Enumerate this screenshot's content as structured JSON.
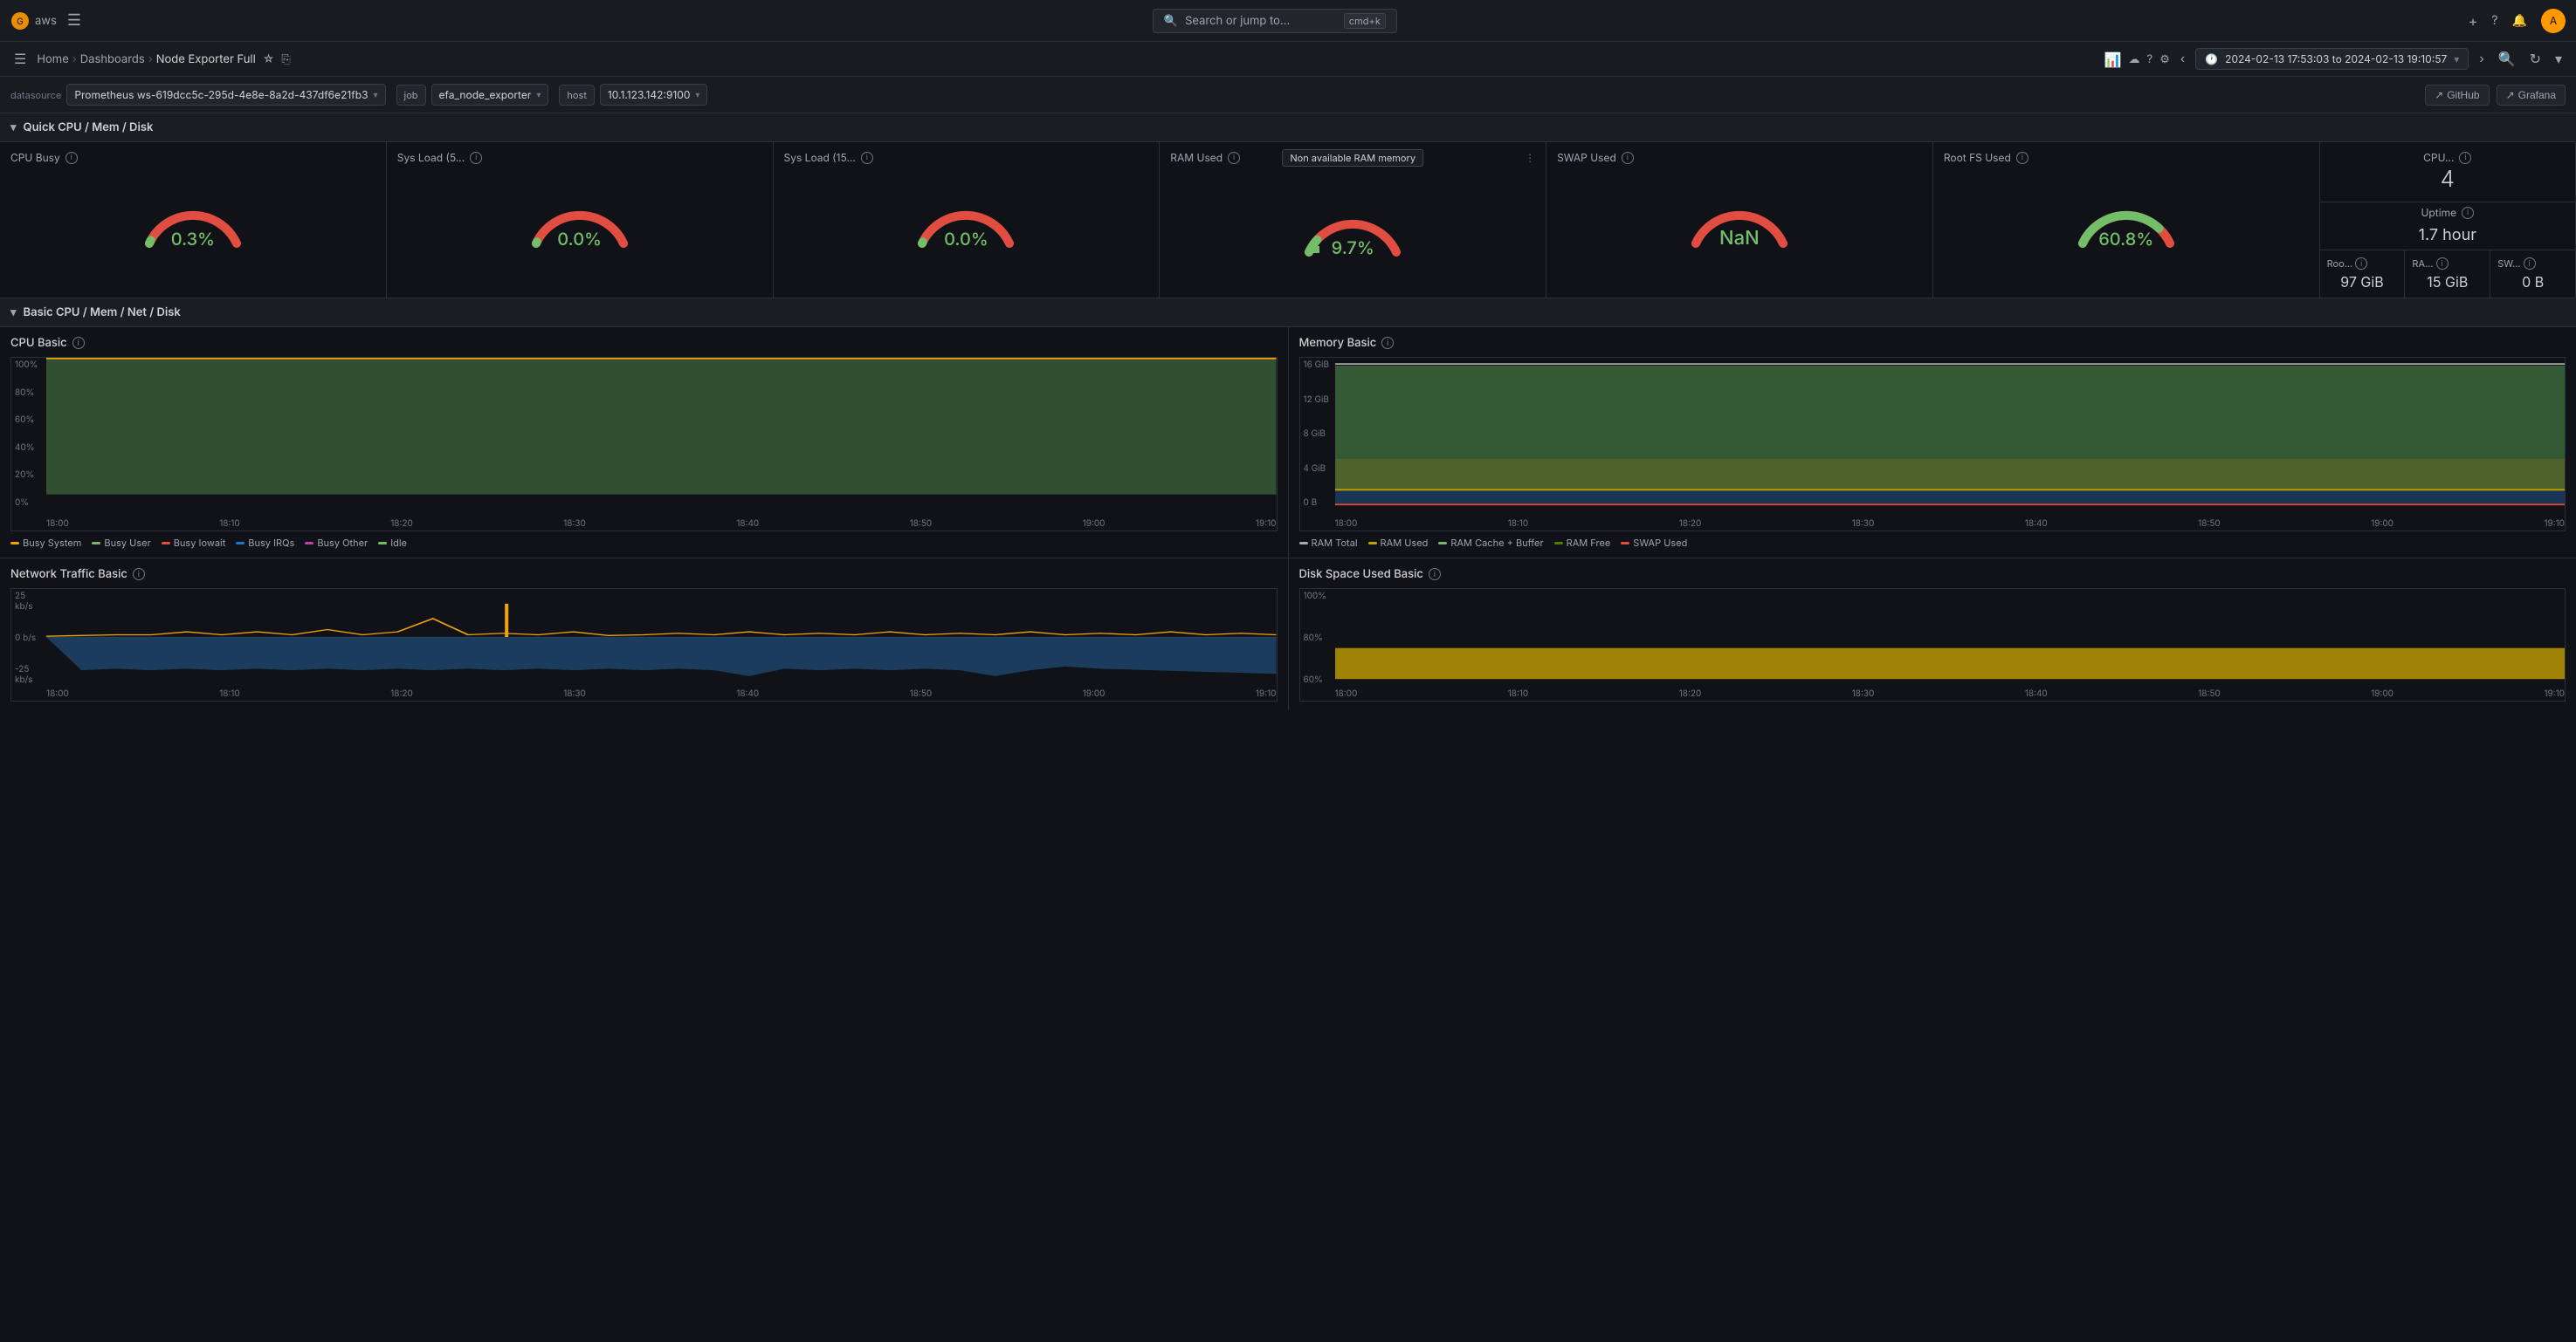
{
  "topnav": {
    "logo": "☁",
    "aws_label": "aws",
    "search_placeholder": "Search or jump to...",
    "shortcut": "cmd+k",
    "icons": [
      "plus",
      "help",
      "bell"
    ],
    "plus_label": "+",
    "help_icon": "?",
    "bell_icon": "🔔"
  },
  "breadcrumb": {
    "home": "Home",
    "dashboards": "Dashboards",
    "page": "Node Exporter Full",
    "time_range": "2024-02-13 17:53:03 to 2024-02-13 19:10:57"
  },
  "filters": {
    "datasource_label": "datasource",
    "datasource_value": "Prometheus ws-619dcc5c-295d-4e8e-8a2d-437df6e21fb3",
    "job_label": "Job",
    "job_value": "efa_node_exporter",
    "host_label": "Host",
    "host_value": "10.1.123.142:9100",
    "github_label": "GitHub",
    "grafana_label": "Grafana"
  },
  "sections": {
    "quick": "Quick CPU / Mem / Disk",
    "basic": "Basic CPU / Mem / Net / Disk"
  },
  "gauges": {
    "cpu_busy": {
      "title": "CPU Busy",
      "value": "0.3%",
      "color": "#73bf69"
    },
    "sys_load_5": {
      "title": "Sys Load (5...",
      "value": "0.0%",
      "color": "#73bf69"
    },
    "sys_load_15": {
      "title": "Sys Load (15...",
      "value": "0.0%",
      "color": "#73bf69"
    },
    "ram_used": {
      "title": "RAM Used",
      "value": "9.7%",
      "color": "#73bf69",
      "tooltip": "Non available RAM memory"
    },
    "swap_used": {
      "title": "SWAP Used",
      "value": "NaN",
      "color": "#73bf69"
    },
    "root_fs": {
      "title": "Root FS Used",
      "value": "60.8%",
      "color": "#73bf69"
    }
  },
  "stats": {
    "cpu_cores": {
      "label": "CPU...",
      "value": "4"
    },
    "uptime": {
      "label": "Uptime",
      "value": "1.7 hour"
    },
    "root_fs": {
      "label": "Roo...",
      "value": "97 GiB"
    },
    "ram": {
      "label": "RA...",
      "value": "15 GiB"
    },
    "swap": {
      "label": "SW...",
      "value": "0 B"
    }
  },
  "cpu_chart": {
    "title": "CPU Basic",
    "y_labels": [
      "100%",
      "80%",
      "60%",
      "40%",
      "20%",
      "0%"
    ],
    "x_labels": [
      "18:00",
      "18:10",
      "18:20",
      "18:30",
      "18:40",
      "18:50",
      "19:00",
      "19:10"
    ],
    "legend": [
      {
        "label": "Busy System",
        "color": "#f0a30a"
      },
      {
        "label": "Busy User",
        "color": "#7eb26d"
      },
      {
        "label": "Busy Iowait",
        "color": "#e24d42"
      },
      {
        "label": "Busy IRQs",
        "color": "#1f78c1"
      },
      {
        "label": "Busy Other",
        "color": "#ba43a9"
      },
      {
        "label": "Idle",
        "color": "#73bf69"
      }
    ]
  },
  "memory_chart": {
    "title": "Memory Basic",
    "y_labels": [
      "16 GiB",
      "12 GiB",
      "8 GiB",
      "4 GiB",
      "0 B"
    ],
    "x_labels": [
      "18:00",
      "18:10",
      "18:20",
      "18:30",
      "18:40",
      "18:50",
      "19:00",
      "19:10"
    ],
    "legend": [
      {
        "label": "RAM Total",
        "color": "#ffffff"
      },
      {
        "label": "RAM Used",
        "color": "#c4a000"
      },
      {
        "label": "RAM Cache + Buffer",
        "color": "#7eb26d"
      },
      {
        "label": "RAM Free",
        "color": "#4e8000"
      },
      {
        "label": "SWAP Used",
        "color": "#e24d42"
      }
    ]
  },
  "network_chart": {
    "title": "Network Traffic Basic",
    "y_labels": [
      "25 kb/s",
      "0 b/s",
      "-25 kb/s"
    ],
    "x_labels": [
      "18:00",
      "18:10",
      "18:20",
      "18:30",
      "18:40",
      "18:50",
      "19:00",
      "19:10"
    ]
  },
  "disk_chart": {
    "title": "Disk Space Used Basic",
    "y_labels": [
      "100%",
      "80%",
      "60%"
    ],
    "x_labels": [
      "18:00",
      "18:10",
      "18:20",
      "18:30",
      "18:40",
      "18:50",
      "19:00",
      "19:10"
    ]
  }
}
